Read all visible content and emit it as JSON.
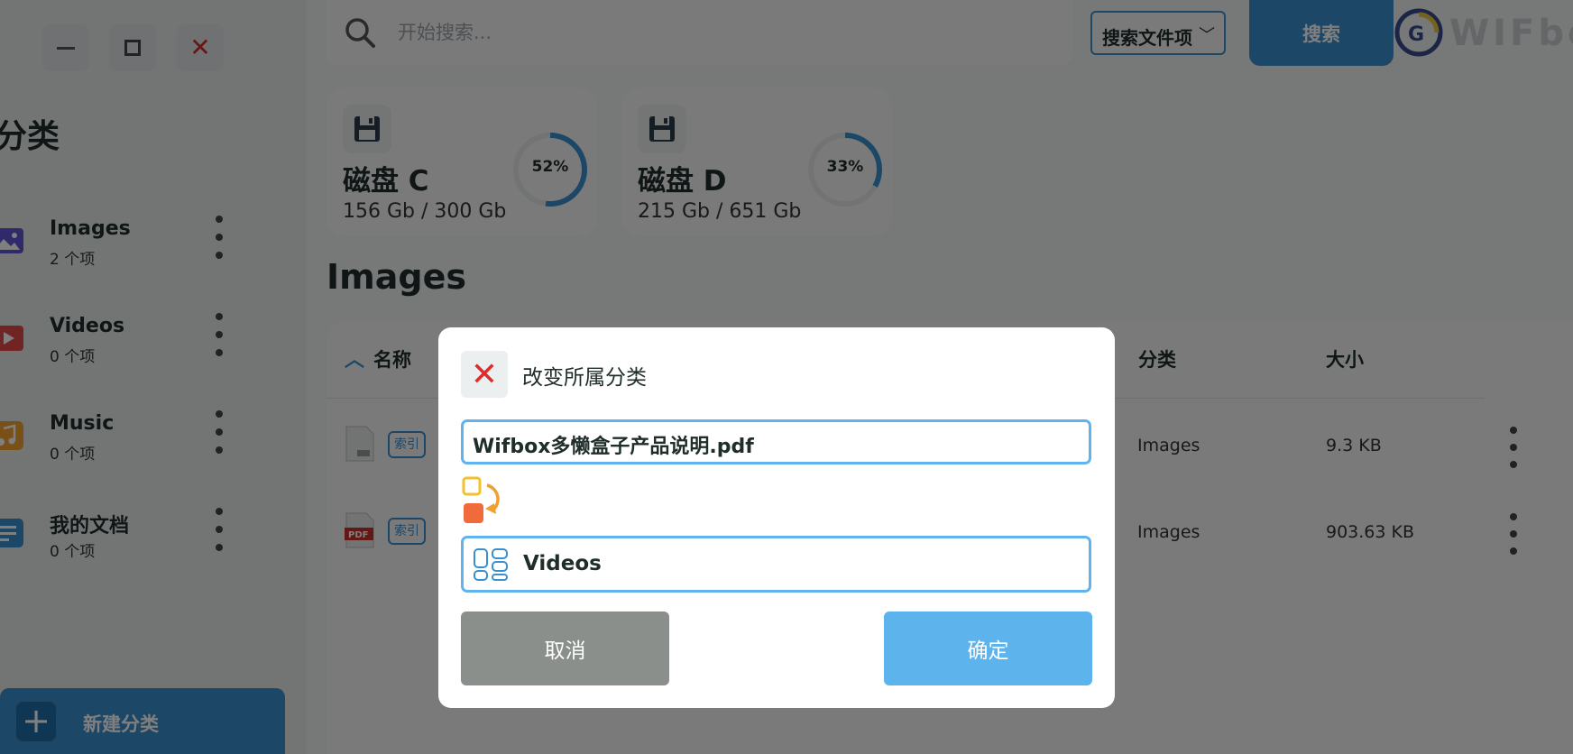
{
  "sidebar": {
    "title": "分类",
    "categories": [
      {
        "name": "Images",
        "count": "2 个项",
        "icon": "image-icon",
        "color": "#5f56d6"
      },
      {
        "name": "Videos",
        "count": "0 个项",
        "icon": "video-icon",
        "color": "#e04848"
      },
      {
        "name": "Music",
        "count": "0 个项",
        "icon": "music-icon",
        "color": "#f0a030"
      },
      {
        "name": "我的文档",
        "count": "0 个项",
        "icon": "document-icon",
        "color": "#3a8fcf"
      }
    ],
    "new_category_label": "新建分类"
  },
  "search": {
    "placeholder": "开始搜索...",
    "filter_label": "搜索文件项",
    "filter_chevron": "﹀",
    "button_label": "搜索"
  },
  "logo": {
    "text": "WIFbo"
  },
  "disks": [
    {
      "name": "磁盘 C",
      "usage": "156 Gb / 300 Gb",
      "percent_label": "52%",
      "percent": 52
    },
    {
      "name": "磁盘 D",
      "usage": "215 Gb / 651 Gb",
      "percent_label": "33%",
      "percent": 33
    }
  ],
  "section": {
    "title": "Images"
  },
  "table": {
    "headers": {
      "name": "名称",
      "category": "分类",
      "size": "大小",
      "sort_indicator": "︿"
    },
    "rows": [
      {
        "tag": "索引",
        "category": "Images",
        "size": "9.3 KB",
        "file_icon": "file-icon"
      },
      {
        "tag": "索引",
        "category": "Images",
        "size": "903.63 KB",
        "file_icon": "pdf-file-icon"
      }
    ]
  },
  "dialog": {
    "close_glyph": "✕",
    "title": "改变所属分类",
    "file_name": "Wifbox多懒盒子产品说明.pdf",
    "target_category": "Videos",
    "cancel_label": "取消",
    "confirm_label": "确定"
  },
  "colors": {
    "accent": "#3a8fcf",
    "dialog_border": "#5fb3ef",
    "confirm": "#5db3ec",
    "cancel": "#8a8f8b",
    "close": "#e02b2b"
  }
}
